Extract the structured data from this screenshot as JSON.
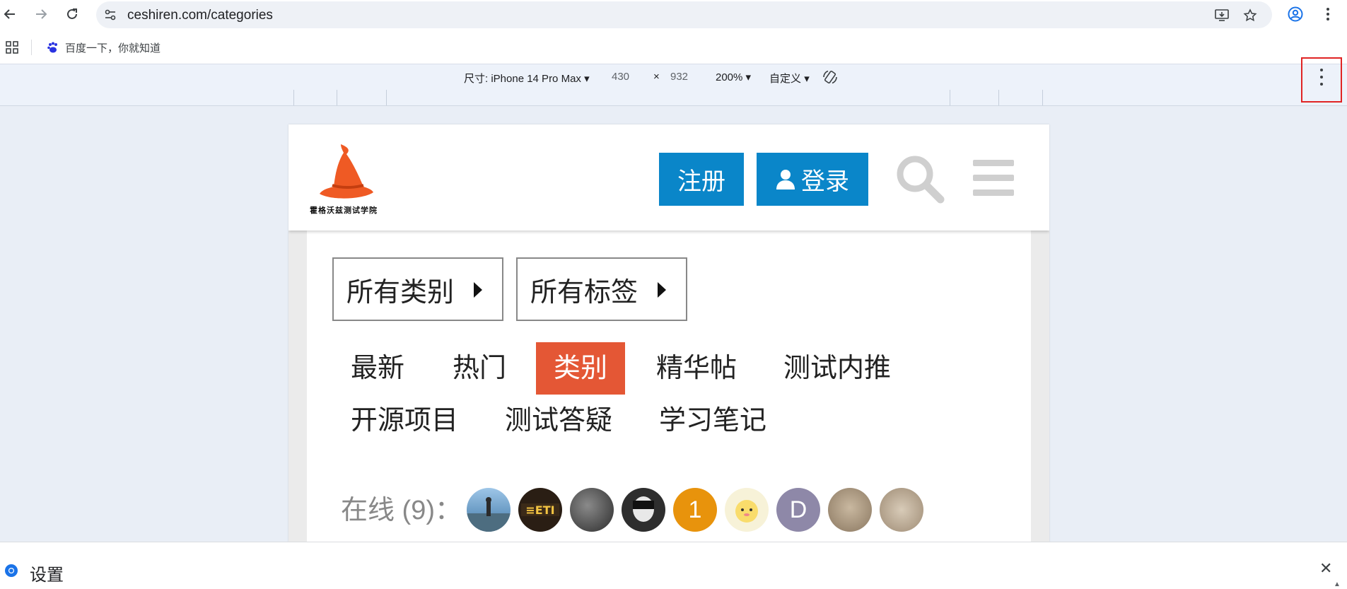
{
  "browser": {
    "url": "ceshiren.com/categories",
    "bookmark_label": "百度一下，你就知道"
  },
  "device_toolbar": {
    "dimensions_label": "尺寸: iPhone 14 Pro Max",
    "width": "430",
    "times": "×",
    "height": "932",
    "zoom": "200%",
    "throttle": "自定义"
  },
  "site": {
    "logo_text": "霍格沃兹测试学院",
    "register_label": "注册",
    "login_label": "登录",
    "all_categories_label": "所有类别",
    "all_tags_label": "所有标签",
    "nav_tabs": [
      "最新",
      "热门",
      "类别",
      "精华帖",
      "测试内推",
      "开源项目",
      "测试答疑",
      "学习笔记"
    ],
    "active_tab": "类别",
    "online_label": "在线 (9)：",
    "avatar_letters": [
      "1",
      "D"
    ],
    "colors": {
      "brand_blue": "#0a86c9",
      "active_tab": "#e45735",
      "avatar_orange": "#e8930c",
      "avatar_purple": "#8e88a8"
    }
  },
  "drawer": {
    "title": "设置"
  }
}
